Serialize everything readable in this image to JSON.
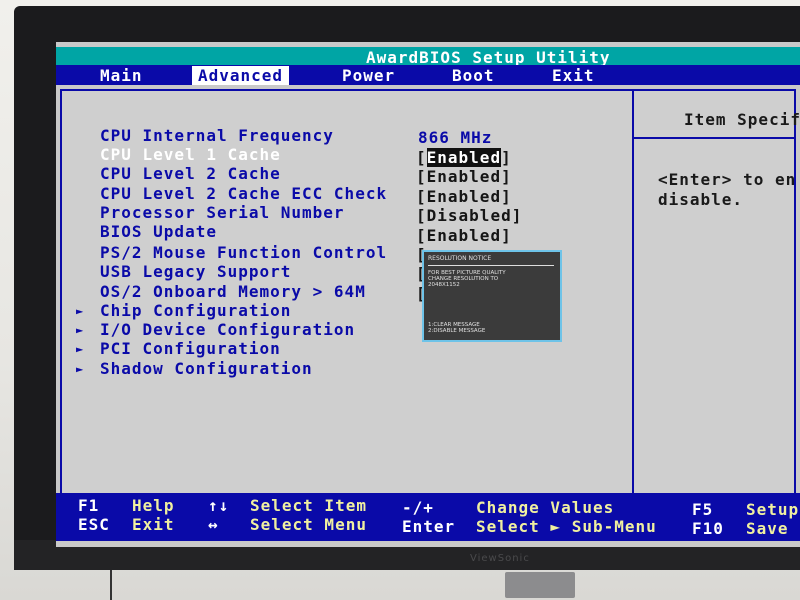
{
  "title": "AwardBIOS Setup Utility",
  "menu": [
    {
      "label": "Main",
      "active": false
    },
    {
      "label": "Advanced",
      "active": true
    },
    {
      "label": "Power",
      "active": false
    },
    {
      "label": "Boot",
      "active": false
    },
    {
      "label": "Exit",
      "active": false
    }
  ],
  "rows": [
    {
      "label": "CPU Internal Frequency",
      "value": "866 MHz"
    },
    {
      "label": "CPU Level 1 Cache",
      "value": "Enabled"
    },
    {
      "label": "CPU Level 2 Cache",
      "value": "Enabled"
    },
    {
      "label": "CPU Level 2 Cache ECC Check",
      "value": "Enabled"
    },
    {
      "label": "Processor Serial Number",
      "value": "Disabled"
    },
    {
      "label": "BIOS Update",
      "value": "Enabled"
    },
    {
      "label": "PS/2 Mouse Function Control",
      "value": "["
    },
    {
      "label": "USB Legacy Support",
      "value": "["
    },
    {
      "label": "OS/2 Onboard Memory > 64M",
      "value": "["
    }
  ],
  "submenus": [
    "Chip Configuration",
    "I/O Device Configuration",
    "PCI Configuration",
    "Shadow Configuration"
  ],
  "help": {
    "title": "Item Specif",
    "text": "<Enter> to en\ndisable."
  },
  "notice": {
    "title": "RESOLUTION NOTICE",
    "body": "FOR BEST PICTURE QUALITY\nCHANGE RESOLUTION TO\n2048X1152",
    "options": "1:CLEAR MESSAGE\n2:DISABLE MESSAGE"
  },
  "footer": {
    "f1_key": "F1",
    "f1_desc": "Help",
    "esc_key": "ESC",
    "esc_desc": "Exit",
    "updown_key": "↑↓",
    "updown_desc": "Select Item",
    "leftright_key": "↔",
    "leftright_desc": "Select Menu",
    "pm_key": "-/+",
    "pm_desc": "Change Values",
    "enter_key": "Enter",
    "enter_desc": "Select ► Sub-Menu",
    "f5_key": "F5",
    "f5_desc": "Setup",
    "f10_key": "F10",
    "f10_desc": "Save"
  },
  "monitor_brand": "ViewSonic"
}
